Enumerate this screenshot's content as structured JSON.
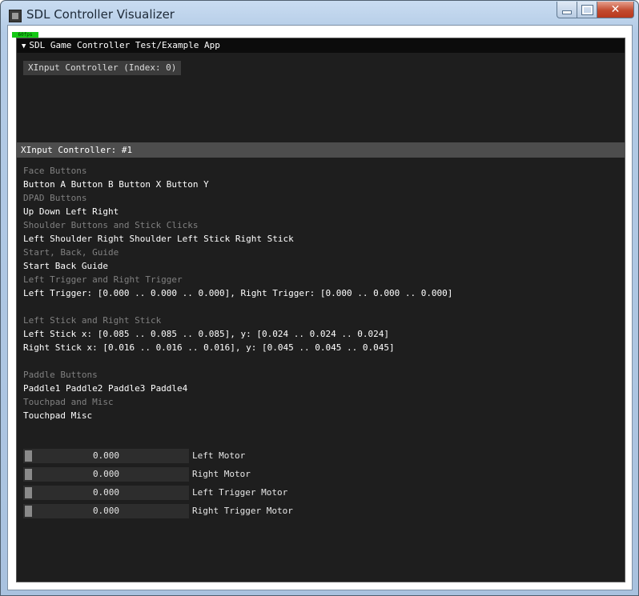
{
  "window": {
    "title": "SDL Controller Visualizer",
    "buttons": {
      "minimize_icon": "minimize-icon",
      "maximize_icon": "maximize-icon",
      "close_icon": "close-icon",
      "close_glyph": "✕"
    }
  },
  "fps_overlay": "60fps",
  "panel1": {
    "title": "SDL Game Controller Test/Example App",
    "collapse_glyph": "▼",
    "controller_button": "XInput Controller (Index: 0)"
  },
  "panel2": {
    "title": "XInput Controller: #1",
    "sections": {
      "face_buttons_heading": "Face Buttons",
      "face_buttons": "Button A Button B Button X Button Y",
      "dpad_heading": "DPAD Buttons",
      "dpad": "Up Down Left Right",
      "shoulder_heading": "Shoulder Buttons and Stick Clicks",
      "shoulder": "Left Shoulder Right Shoulder Left Stick Right Stick",
      "start_heading": "Start, Back, Guide",
      "start": "Start Back Guide",
      "trigger_heading": "Left Trigger and Right Trigger",
      "trigger": "Left Trigger: [0.000 .. 0.000 .. 0.000], Right Trigger: [0.000 .. 0.000 .. 0.000]",
      "stick_heading": "Left Stick and Right Stick",
      "left_stick": "Left Stick x: [0.085 .. 0.085 .. 0.085], y: [0.024 .. 0.024 .. 0.024]",
      "right_stick": "Right Stick x: [0.016 .. 0.016 .. 0.016], y: [0.045 .. 0.045 .. 0.045]",
      "paddle_heading": "Paddle Buttons",
      "paddle": "Paddle1 Paddle2 Paddle3 Paddle4",
      "touchpad_heading": "Touchpad and Misc",
      "touchpad": "Touchpad Misc"
    },
    "motors": [
      {
        "value": "0.000",
        "label": "Left Motor"
      },
      {
        "value": "0.000",
        "label": "Right Motor"
      },
      {
        "value": "0.000",
        "label": "Left Trigger Motor"
      },
      {
        "value": "0.000",
        "label": "Right Trigger Motor"
      }
    ]
  },
  "colors": {
    "panel_bg": "#1e1e1e",
    "header_active": "#4d4d4d",
    "dim_text": "#808080",
    "fps_green": "#14c814"
  }
}
